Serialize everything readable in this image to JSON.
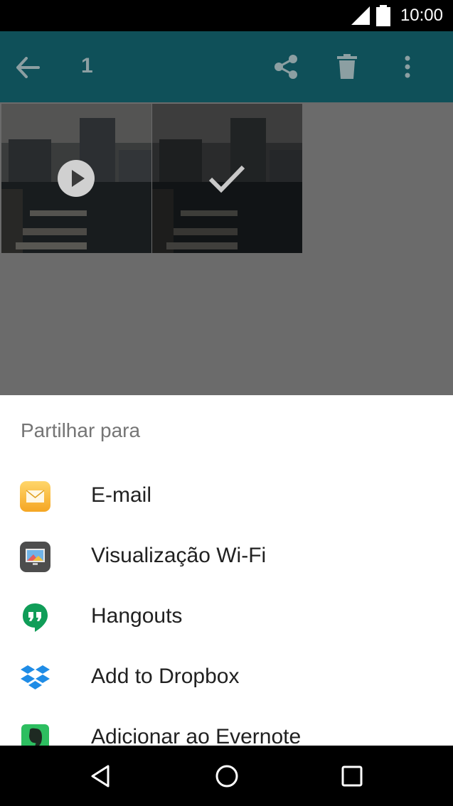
{
  "status_bar": {
    "time": "10:00"
  },
  "app_bar": {
    "selection_count": "1"
  },
  "share_sheet": {
    "title": "Partilhar para",
    "items": [
      {
        "label": "E-mail",
        "icon": "email-app-icon"
      },
      {
        "label": "Visualização Wi-Fi",
        "icon": "wifi-display-app-icon"
      },
      {
        "label": "Hangouts",
        "icon": "hangouts-app-icon"
      },
      {
        "label": "Add to Dropbox",
        "icon": "dropbox-app-icon"
      },
      {
        "label": "Adicionar ao Evernote",
        "icon": "evernote-app-icon"
      }
    ]
  },
  "colors": {
    "app_bar": "#0f5059",
    "scrim": "#6b6b6b",
    "sheet": "#ffffff"
  }
}
